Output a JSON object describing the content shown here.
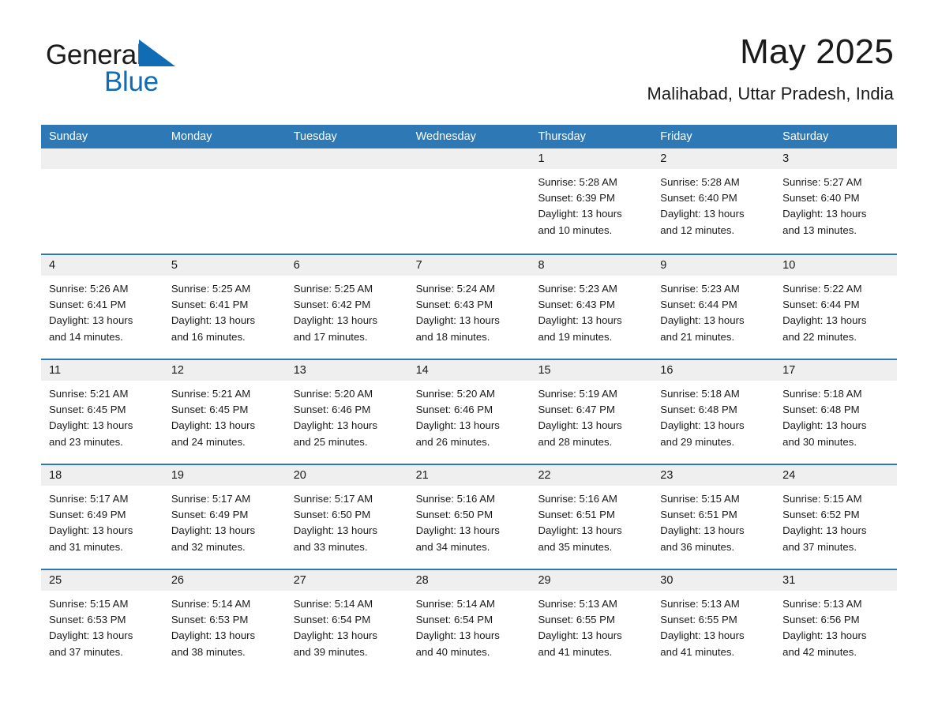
{
  "brand": {
    "name_part1": "General",
    "name_part2": "Blue",
    "triangle_color": "#0f6cb5"
  },
  "header": {
    "title": "May 2025",
    "subtitle": "Malihabad, Uttar Pradesh, India"
  },
  "colors": {
    "header_blue": "#2e79b5",
    "daynum_band": "#efefef",
    "text": "#1a1a1a"
  },
  "calendar": {
    "weekdays": [
      "Sunday",
      "Monday",
      "Tuesday",
      "Wednesday",
      "Thursday",
      "Friday",
      "Saturday"
    ],
    "weeks": [
      [
        {
          "day": "",
          "sunrise": "",
          "sunset": "",
          "daylight1": "",
          "daylight2": ""
        },
        {
          "day": "",
          "sunrise": "",
          "sunset": "",
          "daylight1": "",
          "daylight2": ""
        },
        {
          "day": "",
          "sunrise": "",
          "sunset": "",
          "daylight1": "",
          "daylight2": ""
        },
        {
          "day": "",
          "sunrise": "",
          "sunset": "",
          "daylight1": "",
          "daylight2": ""
        },
        {
          "day": "1",
          "sunrise": "Sunrise: 5:28 AM",
          "sunset": "Sunset: 6:39 PM",
          "daylight1": "Daylight: 13 hours",
          "daylight2": "and 10 minutes."
        },
        {
          "day": "2",
          "sunrise": "Sunrise: 5:28 AM",
          "sunset": "Sunset: 6:40 PM",
          "daylight1": "Daylight: 13 hours",
          "daylight2": "and 12 minutes."
        },
        {
          "day": "3",
          "sunrise": "Sunrise: 5:27 AM",
          "sunset": "Sunset: 6:40 PM",
          "daylight1": "Daylight: 13 hours",
          "daylight2": "and 13 minutes."
        }
      ],
      [
        {
          "day": "4",
          "sunrise": "Sunrise: 5:26 AM",
          "sunset": "Sunset: 6:41 PM",
          "daylight1": "Daylight: 13 hours",
          "daylight2": "and 14 minutes."
        },
        {
          "day": "5",
          "sunrise": "Sunrise: 5:25 AM",
          "sunset": "Sunset: 6:41 PM",
          "daylight1": "Daylight: 13 hours",
          "daylight2": "and 16 minutes."
        },
        {
          "day": "6",
          "sunrise": "Sunrise: 5:25 AM",
          "sunset": "Sunset: 6:42 PM",
          "daylight1": "Daylight: 13 hours",
          "daylight2": "and 17 minutes."
        },
        {
          "day": "7",
          "sunrise": "Sunrise: 5:24 AM",
          "sunset": "Sunset: 6:43 PM",
          "daylight1": "Daylight: 13 hours",
          "daylight2": "and 18 minutes."
        },
        {
          "day": "8",
          "sunrise": "Sunrise: 5:23 AM",
          "sunset": "Sunset: 6:43 PM",
          "daylight1": "Daylight: 13 hours",
          "daylight2": "and 19 minutes."
        },
        {
          "day": "9",
          "sunrise": "Sunrise: 5:23 AM",
          "sunset": "Sunset: 6:44 PM",
          "daylight1": "Daylight: 13 hours",
          "daylight2": "and 21 minutes."
        },
        {
          "day": "10",
          "sunrise": "Sunrise: 5:22 AM",
          "sunset": "Sunset: 6:44 PM",
          "daylight1": "Daylight: 13 hours",
          "daylight2": "and 22 minutes."
        }
      ],
      [
        {
          "day": "11",
          "sunrise": "Sunrise: 5:21 AM",
          "sunset": "Sunset: 6:45 PM",
          "daylight1": "Daylight: 13 hours",
          "daylight2": "and 23 minutes."
        },
        {
          "day": "12",
          "sunrise": "Sunrise: 5:21 AM",
          "sunset": "Sunset: 6:45 PM",
          "daylight1": "Daylight: 13 hours",
          "daylight2": "and 24 minutes."
        },
        {
          "day": "13",
          "sunrise": "Sunrise: 5:20 AM",
          "sunset": "Sunset: 6:46 PM",
          "daylight1": "Daylight: 13 hours",
          "daylight2": "and 25 minutes."
        },
        {
          "day": "14",
          "sunrise": "Sunrise: 5:20 AM",
          "sunset": "Sunset: 6:46 PM",
          "daylight1": "Daylight: 13 hours",
          "daylight2": "and 26 minutes."
        },
        {
          "day": "15",
          "sunrise": "Sunrise: 5:19 AM",
          "sunset": "Sunset: 6:47 PM",
          "daylight1": "Daylight: 13 hours",
          "daylight2": "and 28 minutes."
        },
        {
          "day": "16",
          "sunrise": "Sunrise: 5:18 AM",
          "sunset": "Sunset: 6:48 PM",
          "daylight1": "Daylight: 13 hours",
          "daylight2": "and 29 minutes."
        },
        {
          "day": "17",
          "sunrise": "Sunrise: 5:18 AM",
          "sunset": "Sunset: 6:48 PM",
          "daylight1": "Daylight: 13 hours",
          "daylight2": "and 30 minutes."
        }
      ],
      [
        {
          "day": "18",
          "sunrise": "Sunrise: 5:17 AM",
          "sunset": "Sunset: 6:49 PM",
          "daylight1": "Daylight: 13 hours",
          "daylight2": "and 31 minutes."
        },
        {
          "day": "19",
          "sunrise": "Sunrise: 5:17 AM",
          "sunset": "Sunset: 6:49 PM",
          "daylight1": "Daylight: 13 hours",
          "daylight2": "and 32 minutes."
        },
        {
          "day": "20",
          "sunrise": "Sunrise: 5:17 AM",
          "sunset": "Sunset: 6:50 PM",
          "daylight1": "Daylight: 13 hours",
          "daylight2": "and 33 minutes."
        },
        {
          "day": "21",
          "sunrise": "Sunrise: 5:16 AM",
          "sunset": "Sunset: 6:50 PM",
          "daylight1": "Daylight: 13 hours",
          "daylight2": "and 34 minutes."
        },
        {
          "day": "22",
          "sunrise": "Sunrise: 5:16 AM",
          "sunset": "Sunset: 6:51 PM",
          "daylight1": "Daylight: 13 hours",
          "daylight2": "and 35 minutes."
        },
        {
          "day": "23",
          "sunrise": "Sunrise: 5:15 AM",
          "sunset": "Sunset: 6:51 PM",
          "daylight1": "Daylight: 13 hours",
          "daylight2": "and 36 minutes."
        },
        {
          "day": "24",
          "sunrise": "Sunrise: 5:15 AM",
          "sunset": "Sunset: 6:52 PM",
          "daylight1": "Daylight: 13 hours",
          "daylight2": "and 37 minutes."
        }
      ],
      [
        {
          "day": "25",
          "sunrise": "Sunrise: 5:15 AM",
          "sunset": "Sunset: 6:53 PM",
          "daylight1": "Daylight: 13 hours",
          "daylight2": "and 37 minutes."
        },
        {
          "day": "26",
          "sunrise": "Sunrise: 5:14 AM",
          "sunset": "Sunset: 6:53 PM",
          "daylight1": "Daylight: 13 hours",
          "daylight2": "and 38 minutes."
        },
        {
          "day": "27",
          "sunrise": "Sunrise: 5:14 AM",
          "sunset": "Sunset: 6:54 PM",
          "daylight1": "Daylight: 13 hours",
          "daylight2": "and 39 minutes."
        },
        {
          "day": "28",
          "sunrise": "Sunrise: 5:14 AM",
          "sunset": "Sunset: 6:54 PM",
          "daylight1": "Daylight: 13 hours",
          "daylight2": "and 40 minutes."
        },
        {
          "day": "29",
          "sunrise": "Sunrise: 5:13 AM",
          "sunset": "Sunset: 6:55 PM",
          "daylight1": "Daylight: 13 hours",
          "daylight2": "and 41 minutes."
        },
        {
          "day": "30",
          "sunrise": "Sunrise: 5:13 AM",
          "sunset": "Sunset: 6:55 PM",
          "daylight1": "Daylight: 13 hours",
          "daylight2": "and 41 minutes."
        },
        {
          "day": "31",
          "sunrise": "Sunrise: 5:13 AM",
          "sunset": "Sunset: 6:56 PM",
          "daylight1": "Daylight: 13 hours",
          "daylight2": "and 42 minutes."
        }
      ]
    ]
  }
}
